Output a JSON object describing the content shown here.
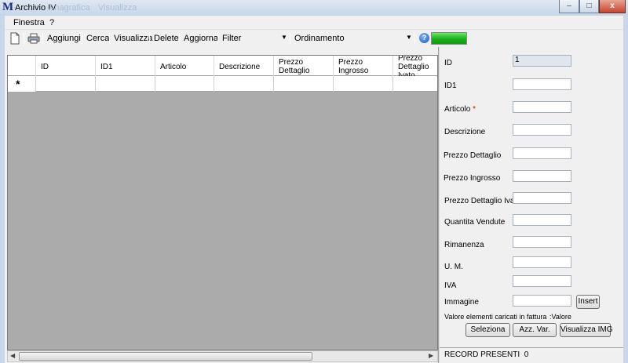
{
  "window": {
    "title": "Archivio IV",
    "ghost_tabs": [
      "Anagrafica",
      "Visualizza"
    ],
    "controls": {
      "minimize": "–",
      "maximize": "□",
      "close": "x"
    }
  },
  "menu": {
    "items": [
      "Finestra",
      "?"
    ]
  },
  "toolbar": {
    "add_label": "Aggiungi",
    "search_label": "Cerca",
    "view_label": "Visualizza",
    "delete_label": "Delete",
    "refresh_label": "Aggiorna",
    "filter_value": "Filter",
    "order_value": "Ordinamento",
    "help_glyph": "?",
    "progress": 1.0,
    "accent_color": "#19b019"
  },
  "grid": {
    "columns": [
      "ID",
      "ID1",
      "Articolo",
      "Descrizione",
      "Prezzo Dettaglio",
      "Prezzo Ingrosso",
      "Prezzo Dettaglio Ivato"
    ],
    "new_row_marker": "*"
  },
  "form": {
    "fields": [
      {
        "label": "ID",
        "value": "1"
      },
      {
        "label": "ID1",
        "value": ""
      },
      {
        "label": "Articolo",
        "required": "*",
        "value": ""
      },
      {
        "label": "Descrizione",
        "value": ""
      },
      {
        "label": "Prezzo Dettaglio",
        "value": ""
      },
      {
        "label": "Prezzo Ingrosso",
        "value": ""
      },
      {
        "label": "Prezzo Dettaglio Ivato",
        "value": ""
      },
      {
        "label": "Quantita Vendute",
        "value": ""
      },
      {
        "label": "Rimanenza",
        "value": ""
      },
      {
        "label": "U. M.",
        "value": ""
      },
      {
        "label": "IVA",
        "value": ""
      },
      {
        "label": "Immagine",
        "value": ""
      }
    ],
    "insert_label": "Insert",
    "invoice_label": "Valore elementi caricati in fattura",
    "value_label": ":Valore",
    "select_label": "Seleziona",
    "reset_label": "Azz. Var.",
    "view_img_label": "Visualizza IMG"
  },
  "status": {
    "record_label": "RECORD PRESENTI",
    "record_count": "0"
  }
}
